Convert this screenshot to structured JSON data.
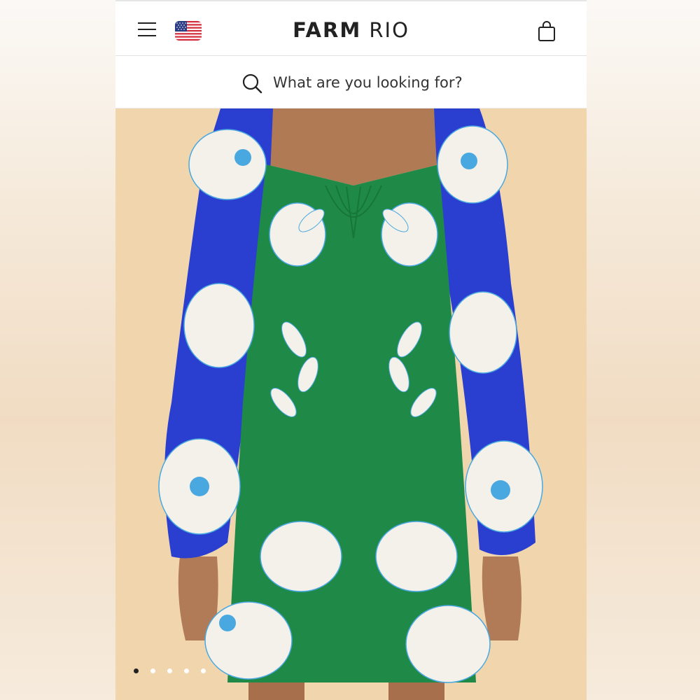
{
  "header": {
    "brand_bold": "FARM",
    "brand_light": "RIO",
    "menu_icon": "hamburger-menu-icon",
    "flag_icon": "us-flag-icon",
    "bag_icon": "shopping-bag-icon"
  },
  "search": {
    "placeholder": "What are you looking for?",
    "icon": "search-icon"
  },
  "product_gallery": {
    "image_subject": "green blue white floral long-sleeve mini dress",
    "total_images": 5,
    "active_index": 0
  },
  "colors": {
    "background": "#f1d6ad",
    "dress_green": "#1f8a48",
    "dress_blue": "#2a3fd0",
    "flower_white": "#f3f1ea",
    "accent_blue": "#4aa8e0"
  }
}
